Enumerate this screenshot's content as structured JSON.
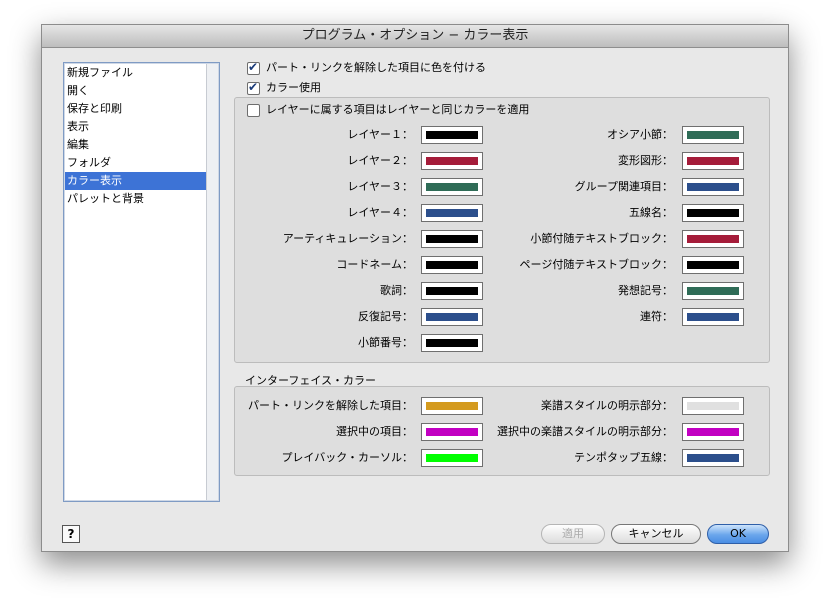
{
  "window": {
    "title": "プログラム・オプション − カラー表示"
  },
  "sidebar": {
    "items": [
      {
        "label": "新規ファイル"
      },
      {
        "label": "開く"
      },
      {
        "label": "保存と印刷"
      },
      {
        "label": "表示"
      },
      {
        "label": "編集"
      },
      {
        "label": "フォルダ"
      },
      {
        "label": "カラー表示",
        "selected": true
      },
      {
        "label": "パレットと背景"
      }
    ]
  },
  "options": {
    "unlink_color": {
      "label": "パート・リンクを解除した項目に色を付ける",
      "checked": true
    },
    "use_color": {
      "label": "カラー使用",
      "checked": true
    },
    "layer_color": {
      "label": "レイヤーに属する項目はレイヤーと同じカラーを適用",
      "checked": false
    }
  },
  "colors": {
    "left": [
      {
        "label": "レイヤー１：",
        "color": "#000000"
      },
      {
        "label": "レイヤー２：",
        "color": "#a51c3a"
      },
      {
        "label": "レイヤー３：",
        "color": "#2f6c57"
      },
      {
        "label": "レイヤー４：",
        "color": "#2c4f8c"
      },
      {
        "label": "アーティキュレーション：",
        "color": "#000000"
      },
      {
        "label": "コードネーム：",
        "color": "#000000"
      },
      {
        "label": "歌詞：",
        "color": "#000000"
      },
      {
        "label": "反復記号：",
        "color": "#2c4f8c"
      },
      {
        "label": "小節番号：",
        "color": "#000000"
      }
    ],
    "right": [
      {
        "label": "オシア小節：",
        "color": "#2f6c57"
      },
      {
        "label": "変形図形：",
        "color": "#a51c3a"
      },
      {
        "label": "グループ関連項目：",
        "color": "#2c4f8c"
      },
      {
        "label": "五線名：",
        "color": "#000000"
      },
      {
        "label": "小節付随テキストブロック：",
        "color": "#a51c3a"
      },
      {
        "label": "ページ付随テキストブロック：",
        "color": "#000000"
      },
      {
        "label": "発想記号：",
        "color": "#2f6c57"
      },
      {
        "label": "連符：",
        "color": "#2c4f8c"
      }
    ]
  },
  "interface": {
    "title": "インターフェイス・カラー",
    "left": [
      {
        "label": "パート・リンクを解除した項目：",
        "color": "#d49a1e"
      },
      {
        "label": "選択中の項目：",
        "color": "#c200c2"
      },
      {
        "label": "プレイバック・カーソル：",
        "color": "#00ff00"
      }
    ],
    "right": [
      {
        "label": "楽譜スタイルの明示部分：",
        "color": "#e0e0e0"
      },
      {
        "label": "選択中の楽譜スタイルの明示部分：",
        "color": "#c200c2"
      },
      {
        "label": "テンポタップ五線：",
        "color": "#2c4f8c"
      }
    ]
  },
  "buttons": {
    "help": "?",
    "apply": "適用",
    "cancel": "キャンセル",
    "ok": "OK"
  }
}
